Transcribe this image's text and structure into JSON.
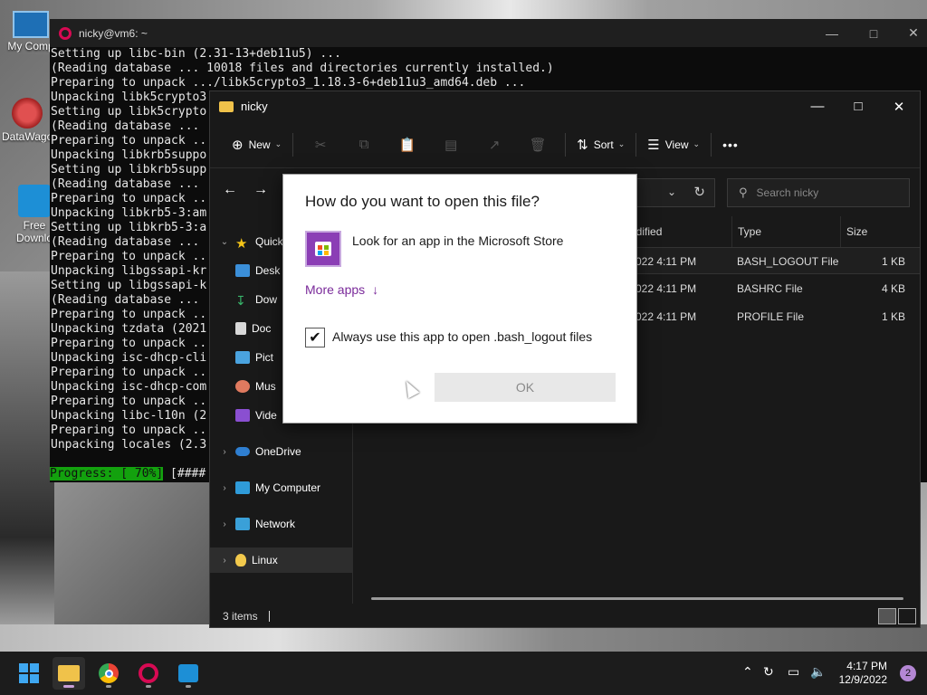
{
  "desktop": {
    "icons": [
      {
        "label": "My Comp"
      },
      {
        "label": "DataWago"
      },
      {
        "label": "Free Downlo"
      }
    ]
  },
  "terminal": {
    "title": "nicky@vm6: ~",
    "lines": [
      "Setting up libc-bin (2.31-13+deb11u5) ...",
      "(Reading database ... 10018 files and directories currently installed.)",
      "Preparing to unpack .../libk5crypto3_1.18.3-6+deb11u3_amd64.deb ...",
      "Unpacking libk5crypto3",
      "Setting up libk5crypto",
      "(Reading database ...",
      "Preparing to unpack ...",
      "Unpacking libkrb5suppo",
      "Setting up libkrb5supp",
      "(Reading database ...",
      "Preparing to unpack ..",
      "Unpacking libkrb5-3:am",
      "Setting up libkrb5-3:a",
      "(Reading database ...",
      "Preparing to unpack ..",
      "Unpacking libgssapi-kr",
      "Setting up libgssapi-k",
      "(Reading database ...",
      "Preparing to unpack ..",
      "Unpacking tzdata (2021",
      "Preparing to unpack ..",
      "Unpacking isc-dhcp-cli",
      "Preparing to unpack ..",
      "Unpacking isc-dhcp-com",
      "Preparing to unpack ..",
      "Unpacking libc-l10n (2",
      "Preparing to unpack ..",
      "Unpacking locales (2.3"
    ],
    "progress_label": "Progress: [ 70%]",
    "progress_bar": " [####"
  },
  "explorer": {
    "title": "nicky",
    "toolbar": {
      "new_label": "New",
      "sort_label": "Sort",
      "view_label": "View",
      "more_label": "•••"
    },
    "search_placeholder": "Search nicky",
    "sidebar": [
      {
        "label": "Quick",
        "icon": "star-icon"
      },
      {
        "label": "Desk",
        "icon": "desktop-icon"
      },
      {
        "label": "Dow",
        "icon": "download-icon"
      },
      {
        "label": "Doc",
        "icon": "document-icon"
      },
      {
        "label": "Pict",
        "icon": "picture-icon"
      },
      {
        "label": "Mus",
        "icon": "music-icon"
      },
      {
        "label": "Vide",
        "icon": "video-icon"
      },
      {
        "label": "OneDrive",
        "icon": "cloud-icon"
      },
      {
        "label": "My Computer",
        "icon": "computer-icon"
      },
      {
        "label": "Network",
        "icon": "network-icon"
      },
      {
        "label": "Linux",
        "icon": "penguin-icon"
      }
    ],
    "columns": {
      "modified": "odified",
      "type": "Type",
      "size": "Size"
    },
    "files": [
      {
        "date": "022 4:11 PM",
        "type": "BASH_LOGOUT File",
        "size": "1 KB"
      },
      {
        "date": "022 4:11 PM",
        "type": "BASHRC File",
        "size": "4 KB"
      },
      {
        "date": "022 4:11 PM",
        "type": "PROFILE File",
        "size": "1 KB"
      }
    ],
    "status": "3 items"
  },
  "dialog": {
    "title": "How do you want to open this file?",
    "store_option": "Look for an app in the Microsoft Store",
    "more_apps": "More apps",
    "checkbox_label": "Always use this app to open .bash_logout files",
    "checkbox_checked": true,
    "ok_label": "OK"
  },
  "taskbar": {
    "time": "4:17 PM",
    "date": "12/9/2022",
    "notification_count": "2"
  },
  "colors": {
    "accent_purple": "#7a2a9a",
    "progress_green": "#13a10e",
    "debian_red": "#d70a53"
  }
}
